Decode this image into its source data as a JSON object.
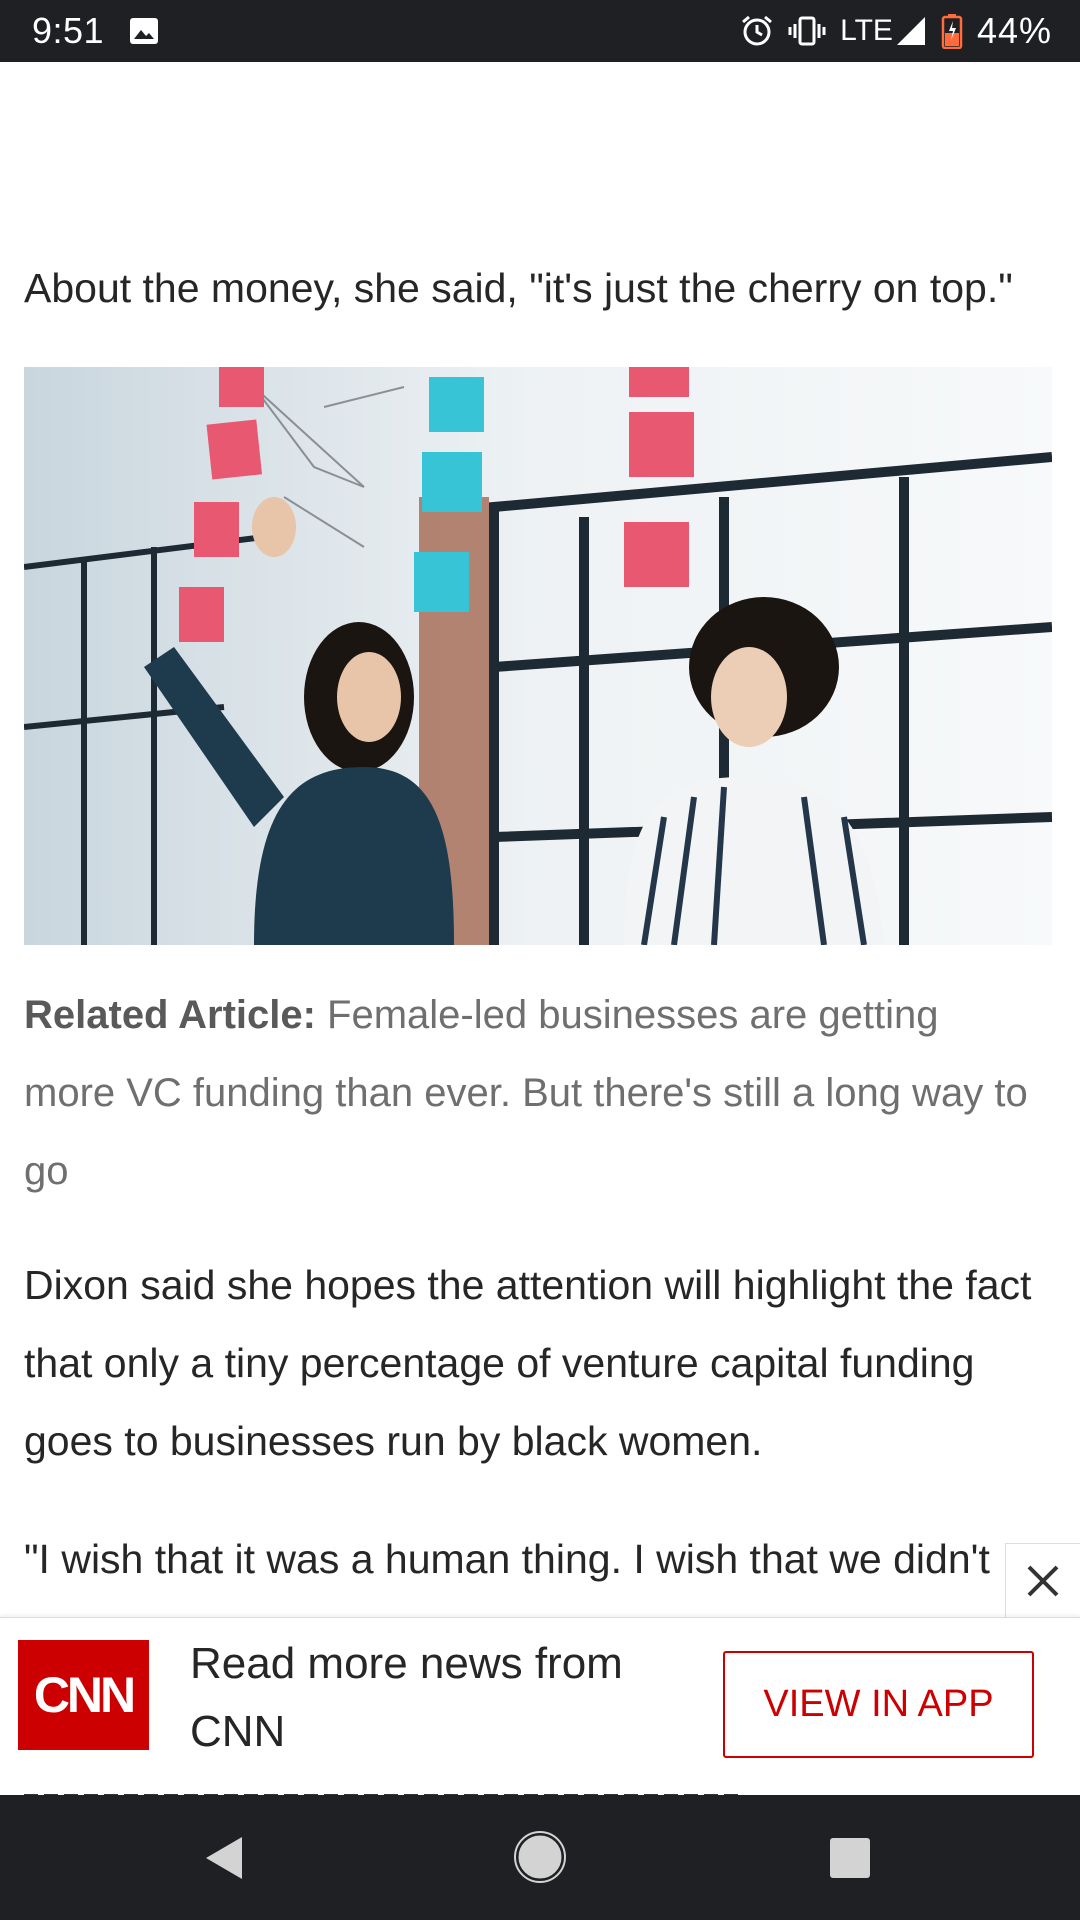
{
  "status_bar": {
    "time": "9:51",
    "network": "LTE",
    "battery_percent": "44%",
    "icons": [
      "image-icon",
      "alarm-icon",
      "vibrate-icon",
      "signal-icon",
      "battery-icon"
    ]
  },
  "article": {
    "quote_paragraph": "About the money, she said, \"it's just the cherry on top.\"",
    "related_label": "Related Article:",
    "related_text": " Female-led businesses are getting more VC funding than ever. But there's still a long way to go",
    "dixon_paragraph": "Dixon said she hopes the attention will highlight the fact that only a tiny percentage of venture capital funding goes to businesses run by black women.",
    "wish_paragraph": "\"I wish that it was a human thing. I wish that we didn't"
  },
  "banner": {
    "logo_text": "CNN",
    "message": "Read more news from CNN",
    "button_label": "VIEW IN APP",
    "brand_color": "#cc0000"
  }
}
